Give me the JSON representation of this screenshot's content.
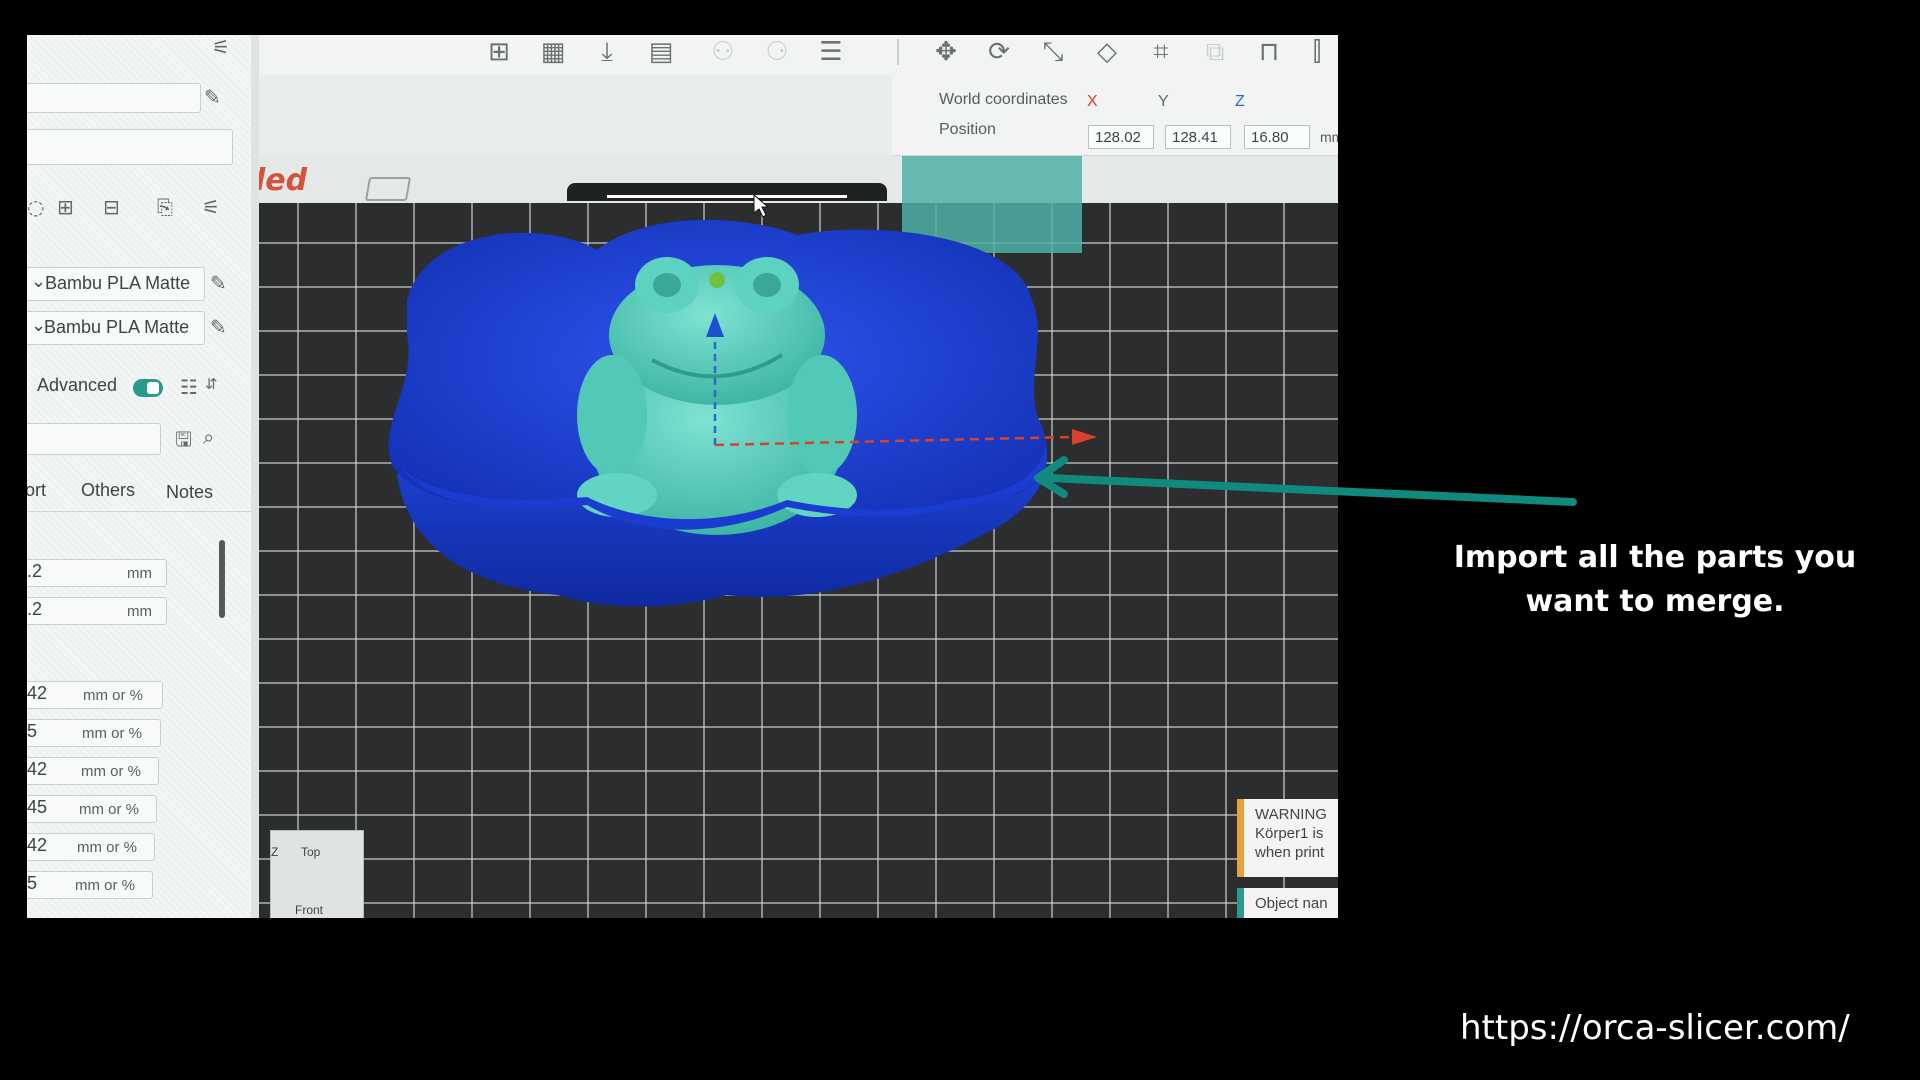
{
  "annotation": {
    "caption": "Import all the parts you want to merge.",
    "url": "https://orca-slicer.com/",
    "arrow_color": "#0f8a7c"
  },
  "toolbar": {
    "icons": [
      "add-plate-icon",
      "arrange-grid-icon",
      "auto-orient-icon",
      "plate-icon",
      "split-objects-icon",
      "split-parts-icon",
      "layers-icon",
      "move-icon",
      "rotate-icon",
      "scale-icon",
      "lay-on-face-icon",
      "cut-icon",
      "boolean-icon",
      "support-paint-icon",
      "seam-paint-icon"
    ]
  },
  "coordinates": {
    "title": "World coordinates",
    "x_label": "X",
    "y_label": "Y",
    "z_label": "Z",
    "position_label": "Position",
    "x": "128.02",
    "y": "128.41",
    "z": "16.80",
    "unit": "mm",
    "x_color": "#d9402e",
    "y_color": "#5c6e6a",
    "z_color": "#2f66c9"
  },
  "plate": {
    "name_fragment": "led"
  },
  "sidebar": {
    "filaments": [
      {
        "name": "Bambu PLA Matte"
      },
      {
        "name": "Bambu PLA Matte"
      }
    ],
    "advanced_label": "Advanced",
    "advanced_on": true,
    "tabs": [
      "ort",
      "Others",
      "Notes"
    ],
    "rows_mm": [
      {
        "value": ".2",
        "unit": "mm"
      },
      {
        "value": ".2",
        "unit": "mm"
      }
    ],
    "rows_pct": [
      {
        "value": "42",
        "unit": "mm or %"
      },
      {
        "value": "5",
        "unit": "mm or %"
      },
      {
        "value": "42",
        "unit": "mm or %"
      },
      {
        "value": "45",
        "unit": "mm or %"
      },
      {
        "value": "42",
        "unit": "mm or %"
      },
      {
        "value": "5",
        "unit": "mm or %"
      }
    ]
  },
  "view_cube": {
    "top": "Top",
    "front": "Front",
    "z": "Z"
  },
  "notifications": [
    {
      "lines": [
        "WARNING",
        "Körper1 is",
        "when print"
      ],
      "color": "#e8a23c"
    },
    {
      "lines": [
        "Object nan"
      ],
      "color": "#2c9a8a"
    }
  ],
  "colors": {
    "bowl": "#1c3fd6",
    "frog": "#4ec9b8",
    "accent": "#2c9a8a"
  }
}
